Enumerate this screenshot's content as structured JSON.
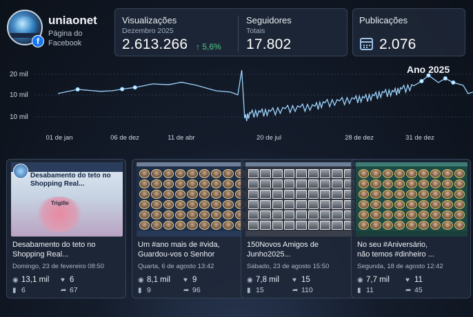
{
  "profile": {
    "name": "uniaonet",
    "subtitle_line1": "Página do",
    "subtitle_line2": "Facebook",
    "facebook_badge": "f"
  },
  "kpis": {
    "views": {
      "label": "Visualizações",
      "period": "Dezembro 2025",
      "value": "2.613.266",
      "delta": "5,6%",
      "delta_color": "#4fd08a"
    },
    "followers": {
      "label": "Seguidores",
      "period": "Totais",
      "value": "17.802"
    },
    "posts": {
      "label": "Publicações",
      "value": "2.076",
      "icon": "calendar-icon"
    }
  },
  "chart_data": {
    "type": "line",
    "year_label": "Ano 2025",
    "y_ticks": [
      "20 mil",
      "10 mil",
      "10 mil"
    ],
    "x_ticks": [
      "01 de jan",
      "06 de dez",
      "11 de abr",
      "20 de jul",
      "28 de dez",
      "31 de dez"
    ],
    "series": [
      {
        "values": [
          [
            0,
            11.0
          ],
          [
            20,
            12.5
          ],
          [
            43,
            11.8
          ],
          [
            55,
            12.0
          ],
          [
            65,
            12.6
          ],
          [
            78,
            13.2
          ],
          [
            96,
            14.5
          ],
          [
            112,
            14.2
          ],
          [
            125,
            15.1
          ],
          [
            140,
            14.0
          ],
          [
            150,
            13.0
          ],
          [
            160,
            12.0
          ],
          [
            175,
            11.5
          ],
          [
            182,
            10.5
          ],
          [
            186,
            19.5
          ],
          [
            189,
            2.0
          ],
          [
            195,
            3.8
          ],
          [
            205,
            4.2
          ],
          [
            215,
            4.5
          ],
          [
            230,
            5.5
          ],
          [
            245,
            6.0
          ],
          [
            260,
            6.4
          ],
          [
            270,
            7.6
          ],
          [
            285,
            8.3
          ],
          [
            300,
            9.0
          ],
          [
            310,
            9.4
          ],
          [
            320,
            10.2
          ],
          [
            330,
            11.3
          ],
          [
            340,
            11.6
          ],
          [
            348,
            12.7
          ],
          [
            360,
            13.8
          ],
          [
            368,
            15.5
          ],
          [
            375,
            17.6
          ],
          [
            385,
            15.0
          ],
          [
            392,
            16.5
          ],
          [
            400,
            15.0
          ],
          [
            410,
            14.0
          ],
          [
            415,
            11.0
          ],
          [
            420,
            11.5
          ]
        ],
        "line_color": "#9fd6ff"
      }
    ],
    "highlighted_points": [
      [
        20,
        12.5
      ],
      [
        65,
        12.6
      ],
      [
        78,
        13.2
      ],
      [
        368,
        15.5
      ],
      [
        375,
        17.6
      ],
      [
        392,
        16.5
      ],
      [
        400,
        15.0
      ]
    ],
    "grid": true
  },
  "posts": [
    {
      "thumb_title": "Desabamento do teto no Shopping Real...",
      "thumb_place": "Trigille",
      "title_line1": "Desabamento do teto no",
      "title_line2": "Shopping Real...",
      "date": "Domingo, 23 de fevereiro 08:50",
      "views": "13,1 mil",
      "reactions": "6",
      "comments": "6",
      "shares": "67"
    },
    {
      "title_line1": "Um #ano mais de #vida,",
      "title_line2": "Guardou-vos o Senhor",
      "date": "Quarta, 6 de agosto 13:42",
      "views": "8,1 mil",
      "reactions": "9",
      "comments": "9",
      "shares": "96"
    },
    {
      "title_line1": "150Novos Amigos de",
      "title_line2": "Junho2025...",
      "date": "Sábado, 23 de agosto 15:50",
      "views": "7,8 mil",
      "reactions": "15",
      "comments": "15",
      "shares": "110"
    },
    {
      "title_line1": "No seu #Aniversário,",
      "title_line2": "não temos #dinheiro ...",
      "date": "Segunda, 18 de agosto 12:42",
      "views": "7,7 mil",
      "reactions": "11",
      "comments": "11",
      "shares": "45"
    }
  ],
  "icons": {
    "views": "eye-icon",
    "reactions": "heart-icon",
    "comments": "comment-icon",
    "shares": "share-icon",
    "delta": "arrow-up-icon"
  }
}
